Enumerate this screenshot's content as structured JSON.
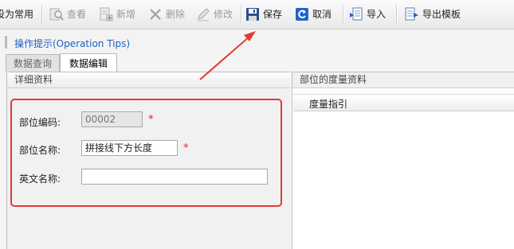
{
  "toolbar": {
    "set_common_label": "设为常用",
    "view_label": "查看",
    "add_label": "新增",
    "delete_label": "删除",
    "edit_label": "修改",
    "save_label": "保存",
    "cancel_label": "取消",
    "import_label": "导入",
    "export_template_label": "导出模板"
  },
  "tips": {
    "label": "操作提示(Operation Tips)"
  },
  "tabs": [
    {
      "label": "数据查询",
      "active": false
    },
    {
      "label": "数据编辑",
      "active": true
    }
  ],
  "detail": {
    "title": "详细资料",
    "code_label": "部位编码:",
    "code_value": "00002",
    "name_label": "部位名称:",
    "name_value": "拼接线下方长度",
    "english_label": "英文名称:",
    "english_value": "",
    "required_mark": "*"
  },
  "measure": {
    "title": "部位的度量资料",
    "column_header": "度量指引"
  },
  "colors": {
    "accent_red": "#e53935",
    "link_blue": "#1f5fbf"
  }
}
